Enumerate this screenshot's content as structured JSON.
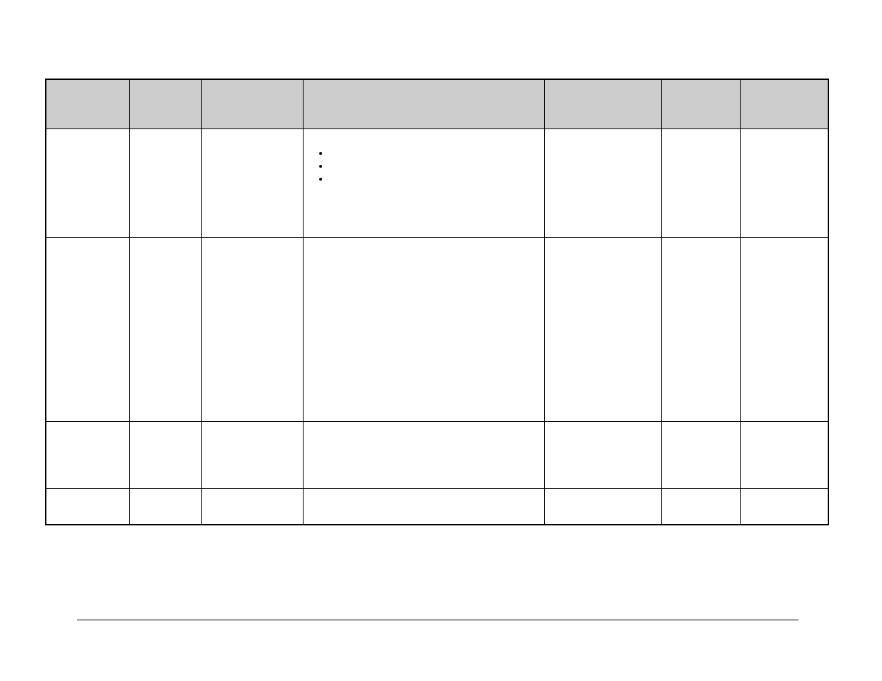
{
  "table": {
    "headers": [
      "",
      "",
      "",
      "",
      "",
      "",
      ""
    ],
    "rows": [
      {
        "c1": "",
        "c2": "",
        "c3": "",
        "c4_bullets": [
          "",
          "",
          ""
        ],
        "c5": "",
        "c6": "",
        "c7": ""
      },
      {
        "c1": "",
        "c2": "",
        "c3": "",
        "c4": "",
        "c5": "",
        "c6": "",
        "c7": ""
      },
      {
        "c1": "",
        "c2": "",
        "c3": "",
        "c4": "",
        "c5": "",
        "c6": "",
        "c7": ""
      },
      {
        "c1": "",
        "c2": "",
        "c3": "",
        "c4": "",
        "c5": "",
        "c6": "",
        "c7": ""
      }
    ]
  }
}
